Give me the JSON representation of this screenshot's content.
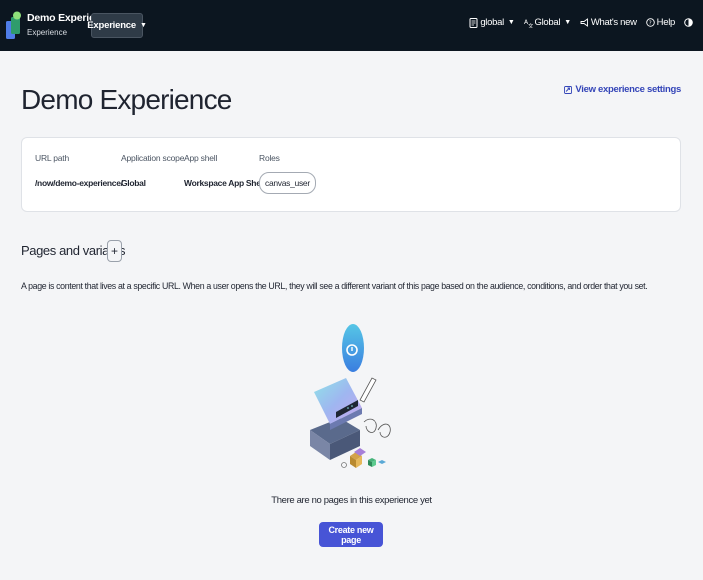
{
  "topbar": {
    "app_title": "Demo Experience",
    "app_subtitle": "Experience",
    "experience_menu_label": "Experience",
    "scope_label": "global",
    "language_label": "Global",
    "whats_new_label": "What's new",
    "help_label": "Help",
    "bg_color": "#0c1620"
  },
  "main": {
    "title": "Demo Experience",
    "settings_link": "View experience settings",
    "info": {
      "url_path_label": "URL path",
      "url_path_value": "/now/demo-experience/",
      "app_scope_label": "Application scope",
      "app_scope_value": "Global",
      "app_shell_label": "App shell",
      "app_shell_value": "Workspace App Shell",
      "roles_label": "Roles",
      "roles": [
        "canvas_user"
      ]
    },
    "pages_section_title": "Pages and variants",
    "add_button_label": "+",
    "description": "A page is content that lives at a specific URL. When a user opens the URL, they will see a different variant of this page based on the audience, conditions, and order that you set.",
    "empty_state_text": "There are no pages in this experience yet",
    "create_button_label": "Create new page",
    "accent_color": "#4754d6"
  }
}
